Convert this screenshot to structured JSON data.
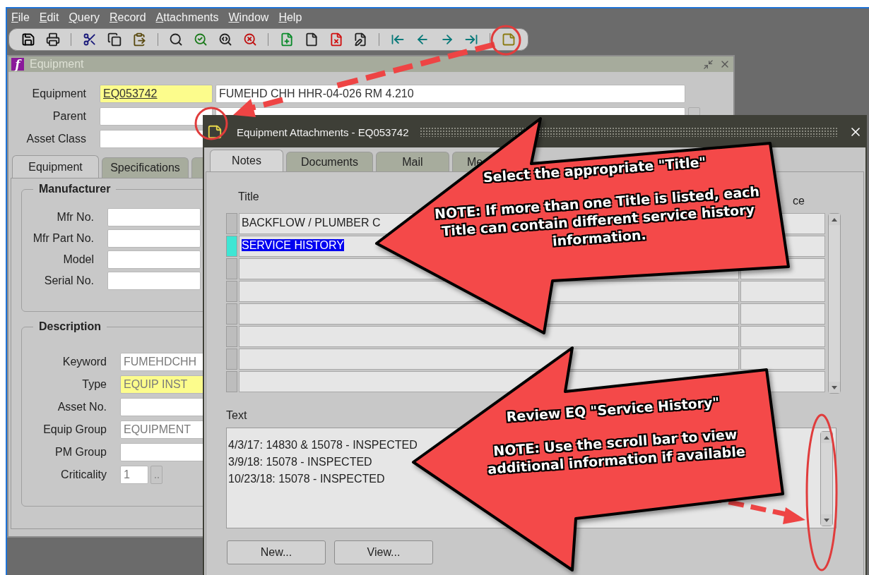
{
  "menu_bar": [
    {
      "label": "File"
    },
    {
      "label": "Edit"
    },
    {
      "label": "Query"
    },
    {
      "label": "Record"
    },
    {
      "label": "Attachments"
    },
    {
      "label": "Window"
    },
    {
      "label": "Help"
    }
  ],
  "equipment_window": {
    "icon_letter": "f",
    "title": "Equipment",
    "header_fields": [
      {
        "label": "Equipment",
        "value": "EQ053742",
        "required": true,
        "readonly": false,
        "link": true
      },
      {
        "label": "Parent",
        "required": false
      },
      {
        "label": "Asset Class",
        "required": false
      }
    ],
    "description_value": "FUMEHD CHH HHR-04-026 RM 4.210",
    "tabs": [
      {
        "label": "Equipment",
        "selected": true
      },
      {
        "label": "Specifications",
        "selected": false
      }
    ],
    "manufacturer": {
      "legend": "Manufacturer",
      "fields": [
        {
          "label": "Mfr No.",
          "required": false
        },
        {
          "label": "Mfr Part No.",
          "required": false
        },
        {
          "label": "Model",
          "required": false
        },
        {
          "label": "Serial No.",
          "required": false
        }
      ]
    },
    "description": {
      "legend": "Description",
      "fields": [
        {
          "label": "Keyword",
          "value": "FUMEHDCHH",
          "required": false,
          "readonly": true
        },
        {
          "label": "Type",
          "value": "EQUIP INST",
          "required": true,
          "readonly": true
        },
        {
          "label": "Asset No.",
          "required": false
        },
        {
          "label": "Equip Group",
          "value": "EQUIPMENT",
          "required": false,
          "readonly": true
        },
        {
          "label": "PM Group",
          "required": false
        },
        {
          "label": "Criticality",
          "value": "1",
          "required": false,
          "readonly": true,
          "lov": true
        }
      ]
    }
  },
  "attachments_window": {
    "title": "Equipment Attachments - EQ053742",
    "tabs": [
      {
        "label": "Notes",
        "selected": true
      },
      {
        "label": "Documents",
        "selected": false
      },
      {
        "label": "Mail",
        "selected": false
      },
      {
        "label": "Me",
        "selected": false
      }
    ],
    "title_label": "Title",
    "column_2_label": "ce",
    "rows": [
      {
        "title": "BACKFLOW / PLUMBER C",
        "selected": false
      },
      {
        "title": "SERVICE HISTORY",
        "selected": true
      },
      {
        "selected": false
      },
      {
        "selected": false
      },
      {
        "selected": false
      },
      {
        "selected": false
      },
      {
        "selected": false
      },
      {
        "selected": false
      }
    ],
    "text_label": "Text",
    "text_lines": [
      "4/3/17: 14830 & 15078 - INSPECTED",
      "3/9/18: 15078 - INSPECTED",
      "10/23/18: 15078 - INSPECTED"
    ],
    "buttons": [
      "New...",
      "View..."
    ]
  },
  "annotations": [
    {
      "kind": "callout",
      "heading": "Select the appropriate \"Title\"",
      "note": "NOTE: If more than one Title is listed, each Title can contain different service history information."
    },
    {
      "kind": "callout",
      "heading": "Review EQ  \"Service  History\"",
      "note": "NOTE: Use the scroll bar to view additional information if available"
    }
  ]
}
